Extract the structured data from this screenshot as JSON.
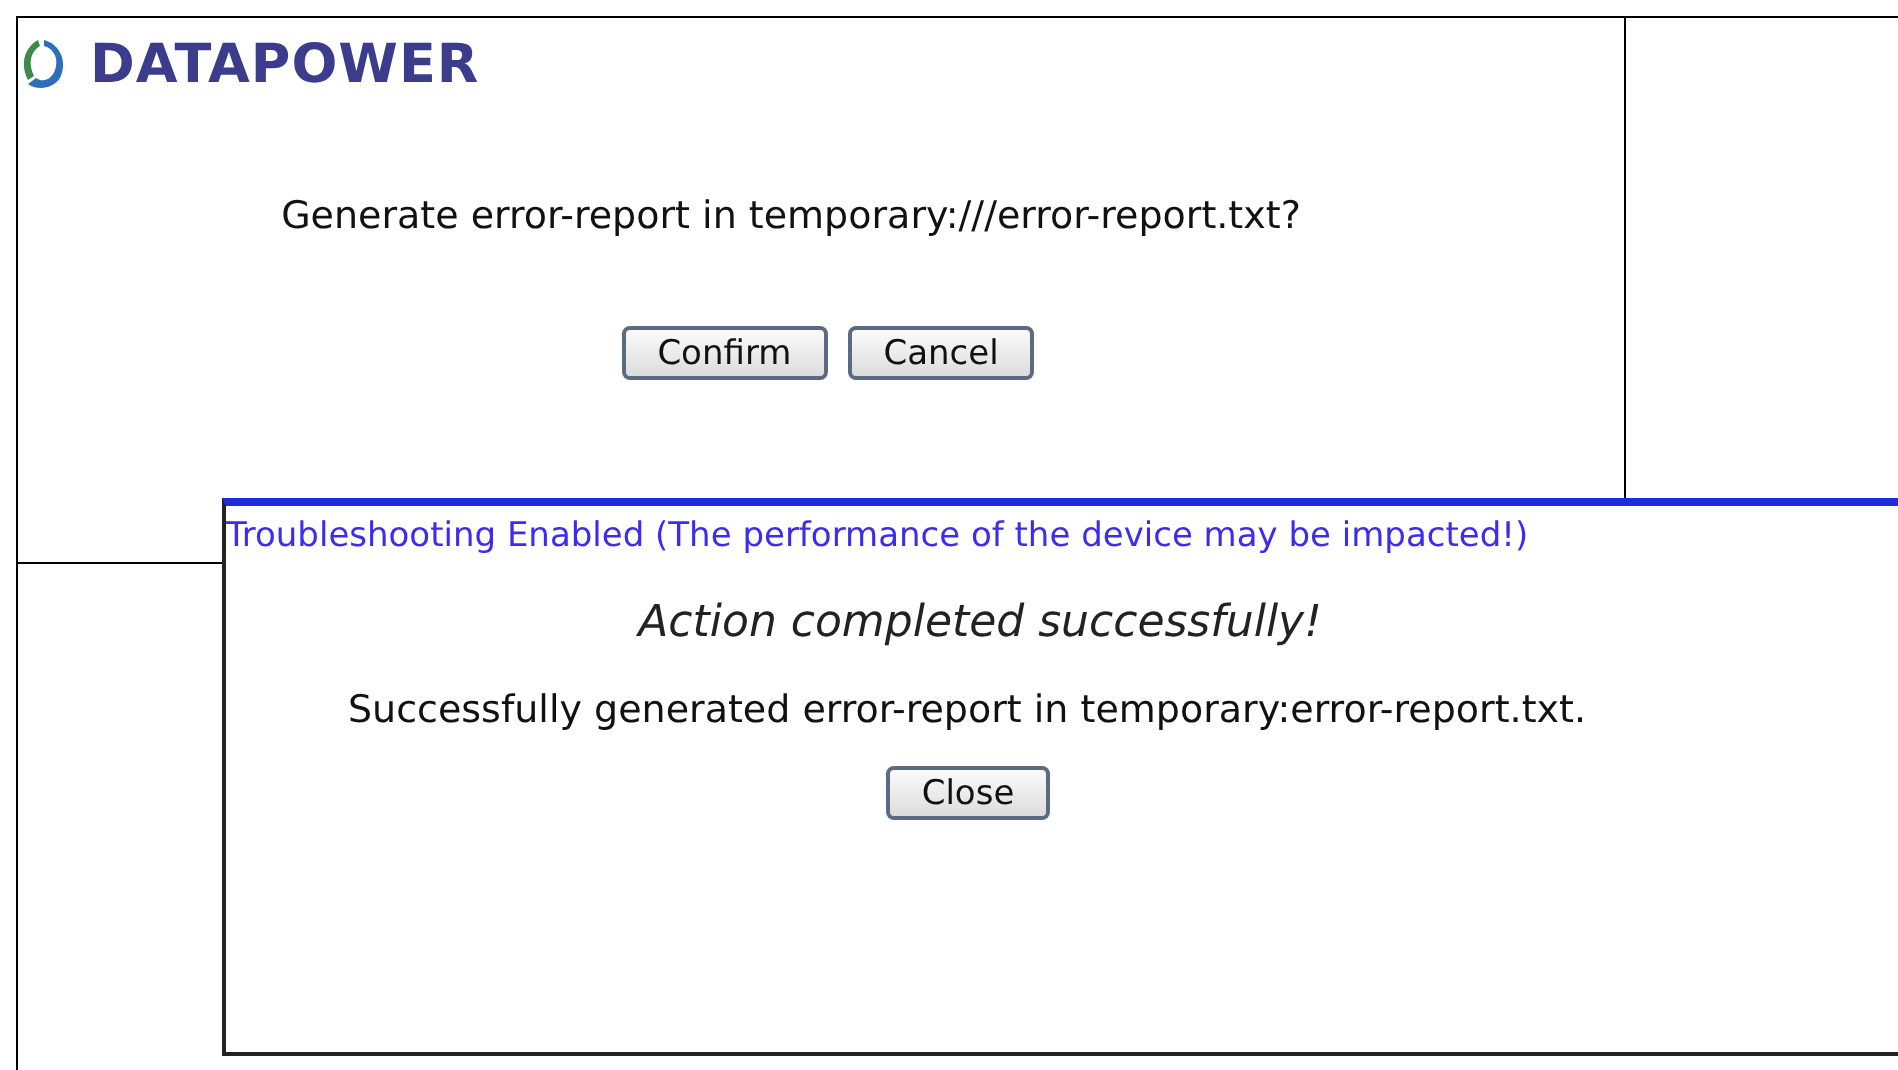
{
  "logo": {
    "text": "DATAPOWER"
  },
  "confirm_dialog": {
    "message": "Generate error-report in temporary:///error-report.txt?",
    "buttons": [
      {
        "label": "Confirm"
      },
      {
        "label": "Cancel"
      }
    ]
  },
  "result_dialog": {
    "banner": "Troubleshooting Enabled (The performance of the device may be impacted!)",
    "title": "Action completed successfully!",
    "message": "Successfully generated error-report in temporary:error-report.txt.",
    "buttons": [
      {
        "label": "Close"
      }
    ]
  }
}
